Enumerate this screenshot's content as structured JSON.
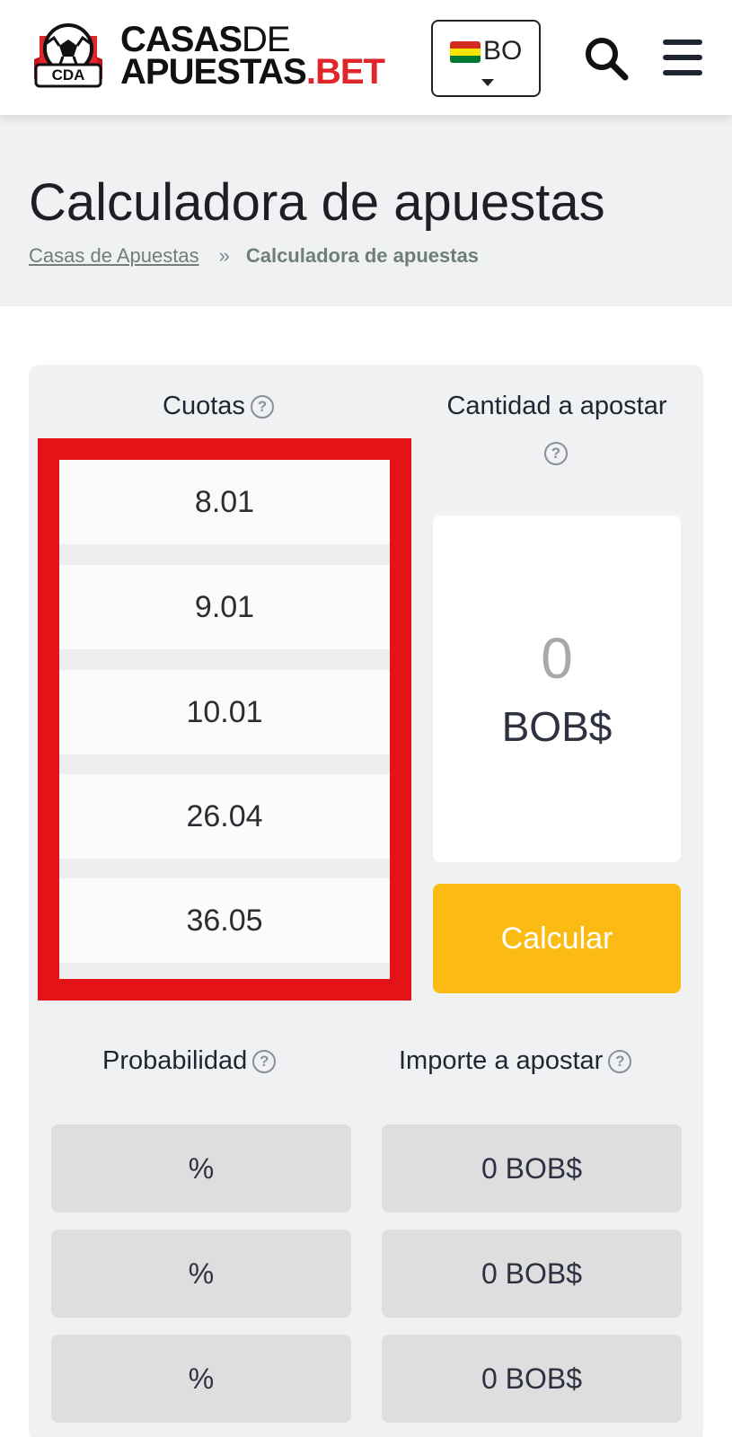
{
  "header": {
    "logo": {
      "badge_text": "CDA",
      "line1_bold": "CASAS",
      "line1_thin": "DE",
      "line2_main": "APUESTAS",
      "line2_accent": ".BET"
    },
    "country": {
      "code": "BO",
      "flag_colors": [
        "#d52b1e",
        "#f9e300",
        "#007934"
      ]
    },
    "icons": {
      "search": "search-icon",
      "menu": "hamburger-menu-icon",
      "dropdown": "caret-down-icon"
    }
  },
  "page": {
    "title": "Calculadora de apuestas",
    "breadcrumb": {
      "home": "Casas de Apuestas",
      "separator": "»",
      "current": "Calculadora de apuestas"
    }
  },
  "calculator": {
    "odds_label": "Cuotas",
    "stake_label": "Cantidad a apostar",
    "help_glyph": "?",
    "odds": [
      "8.01",
      "9.01",
      "10.01",
      "26.04",
      "36.05"
    ],
    "stake_value": "0",
    "currency": "BOB$",
    "calculate_button": "Calcular",
    "probability_label": "Probabilidad",
    "amount_label": "Importe a apostar",
    "results": [
      {
        "probability": "%",
        "amount": "0 BOB$"
      },
      {
        "probability": "%",
        "amount": "0 BOB$"
      },
      {
        "probability": "%",
        "amount": "0 BOB$"
      }
    ],
    "colors": {
      "highlight_border": "#e41317",
      "button": "#fbbb12"
    }
  }
}
